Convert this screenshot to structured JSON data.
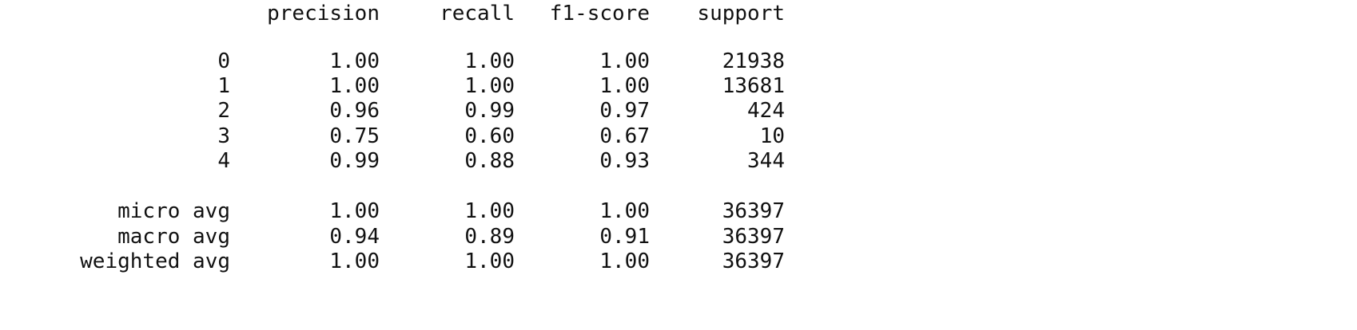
{
  "headers": {
    "label": "",
    "precision": "precision",
    "recall": "recall",
    "f1": "f1-score",
    "support": "support"
  },
  "classes": [
    {
      "label": "0",
      "precision": "1.00",
      "recall": "1.00",
      "f1": "1.00",
      "support": "21938"
    },
    {
      "label": "1",
      "precision": "1.00",
      "recall": "1.00",
      "f1": "1.00",
      "support": "13681"
    },
    {
      "label": "2",
      "precision": "0.96",
      "recall": "0.99",
      "f1": "0.97",
      "support": "424"
    },
    {
      "label": "3",
      "precision": "0.75",
      "recall": "0.60",
      "f1": "0.67",
      "support": "10"
    },
    {
      "label": "4",
      "precision": "0.99",
      "recall": "0.88",
      "f1": "0.93",
      "support": "344"
    }
  ],
  "averages": [
    {
      "label": "micro avg",
      "precision": "1.00",
      "recall": "1.00",
      "f1": "1.00",
      "support": "36397"
    },
    {
      "label": "macro avg",
      "precision": "0.94",
      "recall": "0.89",
      "f1": "0.91",
      "support": "36397"
    },
    {
      "label": "weighted avg",
      "precision": "1.00",
      "recall": "1.00",
      "f1": "1.00",
      "support": "36397"
    }
  ]
}
